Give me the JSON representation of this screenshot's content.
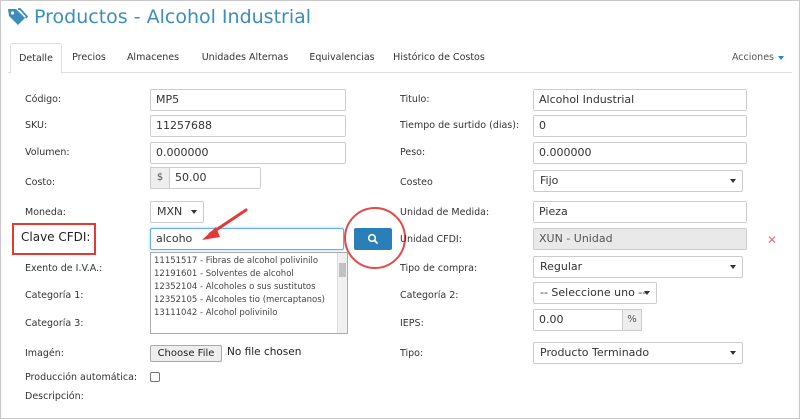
{
  "header": {
    "title": "Productos - Alcohol Industrial",
    "icon": "tags-icon",
    "accent": "#3c8dbc"
  },
  "tabs": [
    {
      "label": "Detalle",
      "active": true
    },
    {
      "label": "Precios"
    },
    {
      "label": "Almacenes"
    },
    {
      "label": "Unidades Alternas"
    },
    {
      "label": "Equivalencias"
    },
    {
      "label": "Histórico de Costos"
    }
  ],
  "actions_label": "Acciones",
  "left": {
    "codigo": {
      "label": "Código:",
      "value": "MP5"
    },
    "sku": {
      "label": "SKU:",
      "value": "11257688"
    },
    "volumen": {
      "label": "Volumen:",
      "value": "0.000000"
    },
    "costo": {
      "label": "Costo:",
      "prefix": "$",
      "value": "50.00"
    },
    "moneda": {
      "label": "Moneda:",
      "value": "MXN"
    },
    "clave_cfdi": {
      "label": "Clave CFDI:",
      "value": "alcoho"
    },
    "exento_iva": {
      "label": "Exento de I.V.A.:"
    },
    "categoria1": {
      "label": "Categoría 1:"
    },
    "categoria3": {
      "label": "Categoría 3:"
    },
    "imagen": {
      "label": "Imagén:",
      "button": "Choose File",
      "status": "No file chosen"
    },
    "produccion_auto": {
      "label": "Producción automática:"
    },
    "descripcion": {
      "label": "Descripción:"
    }
  },
  "suggestions": [
    "11151517 - Fibras de alcohol polivinilo",
    "12191601 - Solventes de alcohol",
    "12352104 - Alcoholes o sus sustitutos",
    "12352105 - Alcoholes tio (mercaptanos)",
    "13111042 - Alcohol polivinilo"
  ],
  "right": {
    "titulo": {
      "label": "Titulo:",
      "value": "Alcohol Industrial"
    },
    "tiempo_surtido": {
      "label": "Tiempo de surtido (dias):",
      "value": "0"
    },
    "peso": {
      "label": "Peso:",
      "value": "0.000000"
    },
    "costeo": {
      "label": "Costeo",
      "value": "Fijo"
    },
    "unidad_medida": {
      "label": "Unidad de Medida:",
      "value": "Pieza"
    },
    "unidad_cfdi": {
      "label": "Unidad CFDI:",
      "value": "XUN - Unidad"
    },
    "tipo_compra": {
      "label": "Tipo de compra:",
      "value": "Regular"
    },
    "categoria2": {
      "label": "Categoría 2:",
      "value": "-- Seleccione uno --"
    },
    "ieps": {
      "label": "IEPS:",
      "value": "0.00",
      "suffix": "%"
    },
    "tipo": {
      "label": "Tipo:",
      "value": "Producto Terminado"
    }
  },
  "colors": {
    "search_button": "#2a7fb8",
    "annotation": "#e53935"
  }
}
